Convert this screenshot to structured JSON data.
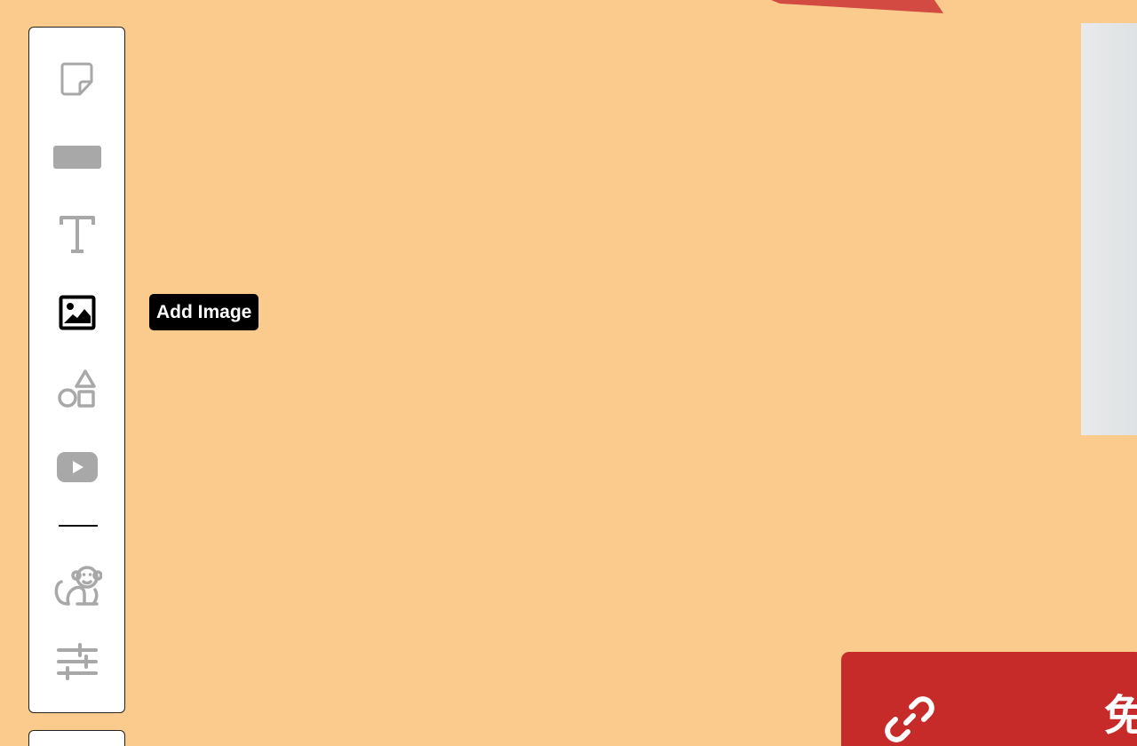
{
  "toolbar": {
    "tools": [
      {
        "name": "sticky-note",
        "icon": "sticky-note-icon",
        "active": false
      },
      {
        "name": "rectangle",
        "icon": "rectangle-icon",
        "active": false
      },
      {
        "name": "text",
        "icon": "text-icon",
        "active": false
      },
      {
        "name": "image",
        "icon": "image-icon",
        "active": true
      },
      {
        "name": "shapes",
        "icon": "shapes-icon",
        "active": false
      },
      {
        "name": "video",
        "icon": "video-play-icon",
        "active": false
      },
      {
        "name": "monkey",
        "icon": "monkey-icon",
        "active": false
      },
      {
        "name": "settings",
        "icon": "sliders-icon",
        "active": false
      }
    ]
  },
  "tooltip": {
    "label": "Add Image"
  },
  "card": {
    "icon": "link-icon",
    "text": "免"
  },
  "colors": {
    "canvas_background": "#FBCB8D",
    "icon_inactive": "#A8A8A8",
    "icon_active": "#000000",
    "card_red": "#C62B2A",
    "ribbon_red": "#D24A41"
  }
}
